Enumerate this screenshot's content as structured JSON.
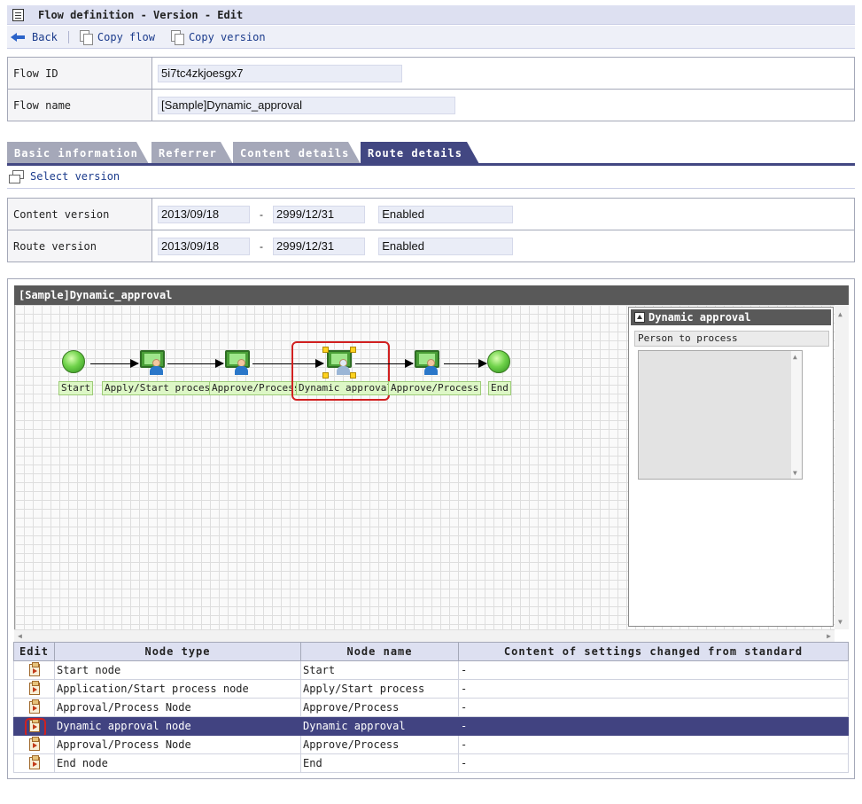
{
  "header": {
    "title": "Flow definition - Version - Edit",
    "icon": "clipboard-icon"
  },
  "toolbar": {
    "back_label": "Back",
    "copy_flow_label": "Copy flow",
    "copy_version_label": "Copy version"
  },
  "flow_info": {
    "flow_id_label": "Flow ID",
    "flow_id_value": "5i7tc4zkjoesgx7",
    "flow_name_label": "Flow name",
    "flow_name_value": "[Sample]Dynamic_approval"
  },
  "tabs": [
    {
      "label": "Basic information",
      "active": false
    },
    {
      "label": "Referrer",
      "active": false
    },
    {
      "label": "Content details",
      "active": false
    },
    {
      "label": "Route details",
      "active": true
    }
  ],
  "select_version_label": "Select version",
  "versions": {
    "content_label": "Content version",
    "content_from": "2013/09/18",
    "content_sep": "-",
    "content_to": "2999/12/31",
    "content_status": "Enabled",
    "route_label": "Route version",
    "route_from": "2013/09/18",
    "route_sep": "-",
    "route_to": "2999/12/31",
    "route_status": "Enabled"
  },
  "flow_editor": {
    "title": "[Sample]Dynamic_approval",
    "nodes": [
      {
        "type": "start",
        "label": "Start"
      },
      {
        "type": "user",
        "label": "Apply/Start process"
      },
      {
        "type": "user",
        "label": "Approve/Process"
      },
      {
        "type": "dynamic",
        "label": "Dynamic approval",
        "selected": true
      },
      {
        "type": "user",
        "label": "Approve/Process"
      },
      {
        "type": "end",
        "label": "End"
      }
    ],
    "properties": {
      "title": "Dynamic approval",
      "field_label": "Person to process"
    }
  },
  "node_table": {
    "headers": [
      "Edit",
      "Node type",
      "Node name",
      "Content of settings changed from standard"
    ],
    "rows": [
      {
        "type": "Start node",
        "name": "Start",
        "changed": "-",
        "selected": false
      },
      {
        "type": "Application/Start process node",
        "name": "Apply/Start process",
        "changed": "-",
        "selected": false
      },
      {
        "type": "Approval/Process Node",
        "name": "Approve/Process",
        "changed": "-",
        "selected": false
      },
      {
        "type": "Dynamic approval node",
        "name": "Dynamic approval",
        "changed": "-",
        "selected": true
      },
      {
        "type": "Approval/Process Node",
        "name": "Approve/Process",
        "changed": "-",
        "selected": false
      },
      {
        "type": "End node",
        "name": "End",
        "changed": "-",
        "selected": false
      }
    ]
  },
  "colors": {
    "accent": "#424782",
    "tab_inactive": "#a5a8b9",
    "header_bg": "#dde0f1",
    "highlight": "#d12020"
  }
}
